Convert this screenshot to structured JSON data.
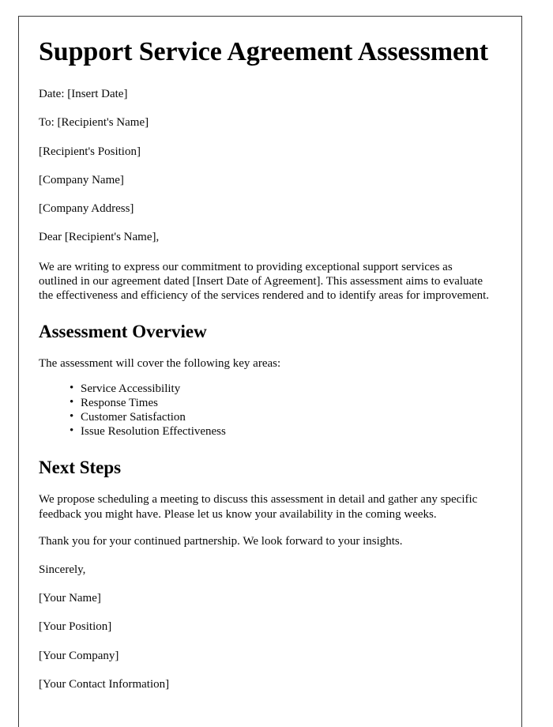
{
  "document": {
    "title": "Support Service Agreement Assessment",
    "header_fields": [
      "Date: [Insert Date]",
      "To: [Recipient's Name]",
      "[Recipient's Position]",
      "[Company Name]",
      "[Company Address]"
    ],
    "salutation": "Dear [Recipient's Name],",
    "intro_paragraph": "We are writing to express our commitment to providing exceptional support services as outlined in our agreement dated [Insert Date of Agreement]. This assessment aims to evaluate the effectiveness and efficiency of the services rendered and to identify areas for improvement.",
    "sections": [
      {
        "heading": "Assessment Overview",
        "lead_in": "The assessment will cover the following key areas:",
        "bullets": [
          "Service Accessibility",
          "Response Times",
          "Customer Satisfaction",
          "Issue Resolution Effectiveness"
        ]
      },
      {
        "heading": "Next Steps",
        "paragraphs": [
          "We propose scheduling a meeting to discuss this assessment in detail and gather any specific feedback you might have. Please let us know your availability in the coming weeks.",
          "Thank you for your continued partnership. We look forward to your insights."
        ]
      }
    ],
    "closing": "Sincerely,",
    "signature_block": [
      "[Your Name]",
      "[Your Position]",
      "[Your Company]",
      "[Your Contact Information]"
    ],
    "colors": {
      "page_background": "#ffffff",
      "page_border": "#3a3a3a",
      "text": "#0a0a0a",
      "heading_text": "#000000"
    }
  }
}
